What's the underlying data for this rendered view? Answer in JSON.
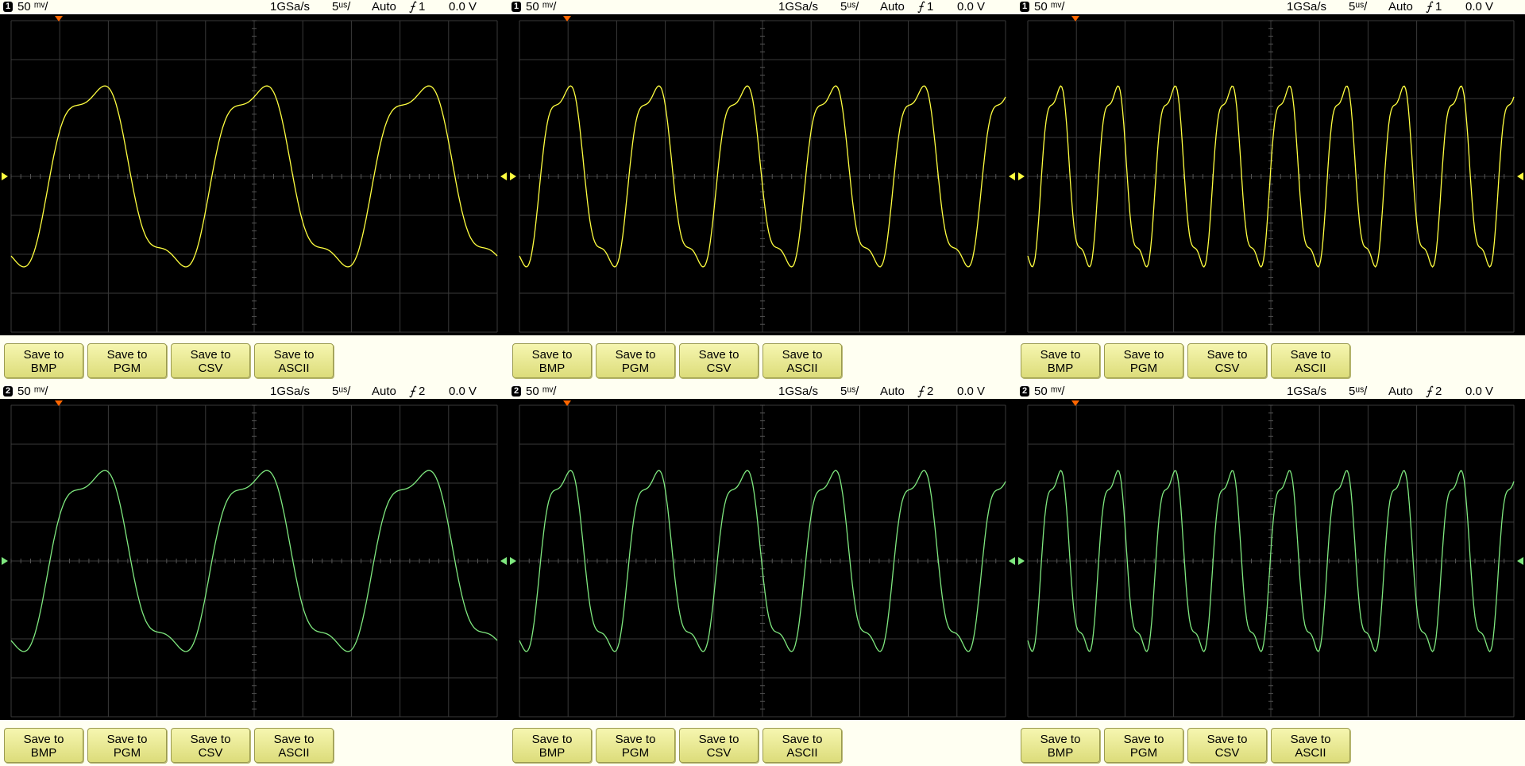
{
  "panels": [
    {
      "id": "top-left",
      "channel": "1",
      "volts_div": "50 ᵐᵛ/",
      "sample_rate": "1GSa/s",
      "time_div": "5ᵘˢ/",
      "trigger_mode": "Auto",
      "trigger_channel": "1",
      "trigger_level": "0.0 V",
      "cycles": 3,
      "trace_color": "#ffff40"
    },
    {
      "id": "top-middle",
      "channel": "1",
      "volts_div": "50 ᵐᵛ/",
      "sample_rate": "1GSa/s",
      "time_div": "5ᵘˢ/",
      "trigger_mode": "Auto",
      "trigger_channel": "1",
      "trigger_level": "0.0 V",
      "cycles": 5.5,
      "trace_color": "#ffff40"
    },
    {
      "id": "top-right",
      "channel": "1",
      "volts_div": "50 ᵐᵛ/",
      "sample_rate": "1GSa/s",
      "time_div": "5ᵘˢ/",
      "trigger_mode": "Auto",
      "trigger_channel": "1",
      "trigger_level": "0.0 V",
      "cycles": 8.5,
      "trace_color": "#ffff40"
    },
    {
      "id": "bottom-left",
      "channel": "2",
      "volts_div": "50 ᵐᵛ/",
      "sample_rate": "1GSa/s",
      "time_div": "5ᵘˢ/",
      "trigger_mode": "Auto",
      "trigger_channel": "2",
      "trigger_level": "0.0 V",
      "cycles": 3,
      "trace_color": "#7fe87f"
    },
    {
      "id": "bottom-middle",
      "channel": "2",
      "volts_div": "50 ᵐᵛ/",
      "sample_rate": "1GSa/s",
      "time_div": "5ᵘˢ/",
      "trigger_mode": "Auto",
      "trigger_channel": "2",
      "trigger_level": "0.0 V",
      "cycles": 5.5,
      "trace_color": "#7fe87f"
    },
    {
      "id": "bottom-right",
      "channel": "2",
      "volts_div": "50 ᵐᵛ/",
      "sample_rate": "1GSa/s",
      "time_div": "5ᵘˢ/",
      "trigger_mode": "Auto",
      "trigger_channel": "2",
      "trigger_level": "0.0 V",
      "cycles": 8.5,
      "trace_color": "#7fe87f"
    }
  ],
  "buttons": [
    {
      "line1": "Save to",
      "line2": "BMP"
    },
    {
      "line1": "Save to",
      "line2": "PGM"
    },
    {
      "line1": "Save to",
      "line2": "CSV"
    },
    {
      "line1": "Save to",
      "line2": "ASCII"
    }
  ],
  "grid_color": "#3a3a3a",
  "trigger_marker_color": "#ff6600",
  "icons": {
    "trigger_edge": "rising-edge-icon",
    "trigger_position": "trigger-position-icon",
    "ground_marker": "ground-level-icon"
  }
}
